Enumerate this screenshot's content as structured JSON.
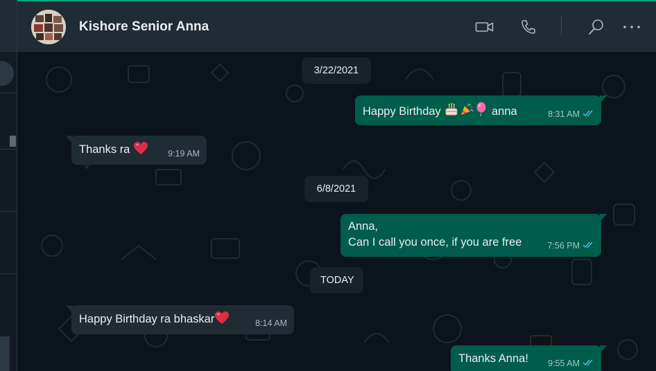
{
  "contact": {
    "name": "Kishore Senior Anna"
  },
  "header_icons": [
    "video-call-icon",
    "voice-call-icon",
    "search-icon",
    "more-options-icon"
  ],
  "dates": [
    "3/22/2021",
    "6/8/2021",
    "TODAY"
  ],
  "messages": [
    {
      "direction": "outgoing",
      "text": "Happy Birthday",
      "suffix": " anna",
      "emojis": [
        "birthday-cake",
        "party-popper",
        "balloon"
      ],
      "time": "8:31 AM",
      "status": "read"
    },
    {
      "direction": "incoming",
      "text": "Thanks ra",
      "emojis": [
        "red-heart"
      ],
      "time": "9:19 AM"
    },
    {
      "direction": "outgoing",
      "line1": "Anna,",
      "line2": "Can I call you once, if you are free",
      "time": "7:56 PM",
      "status": "read"
    },
    {
      "direction": "incoming",
      "text": "Happy Birthday ra bhaskar",
      "emojis": [
        "red-heart"
      ],
      "time": "8:14 AM"
    },
    {
      "direction": "outgoing",
      "text": "Thanks Anna!",
      "time": "9:55 AM",
      "status": "read"
    }
  ],
  "colors": {
    "accent": "#00a884",
    "outgoing_bubble": "#005c4b",
    "incoming_bubble": "#202c33",
    "header": "#202c33",
    "chat_bg": "#0b141a",
    "read_tick": "#53bdeb"
  }
}
